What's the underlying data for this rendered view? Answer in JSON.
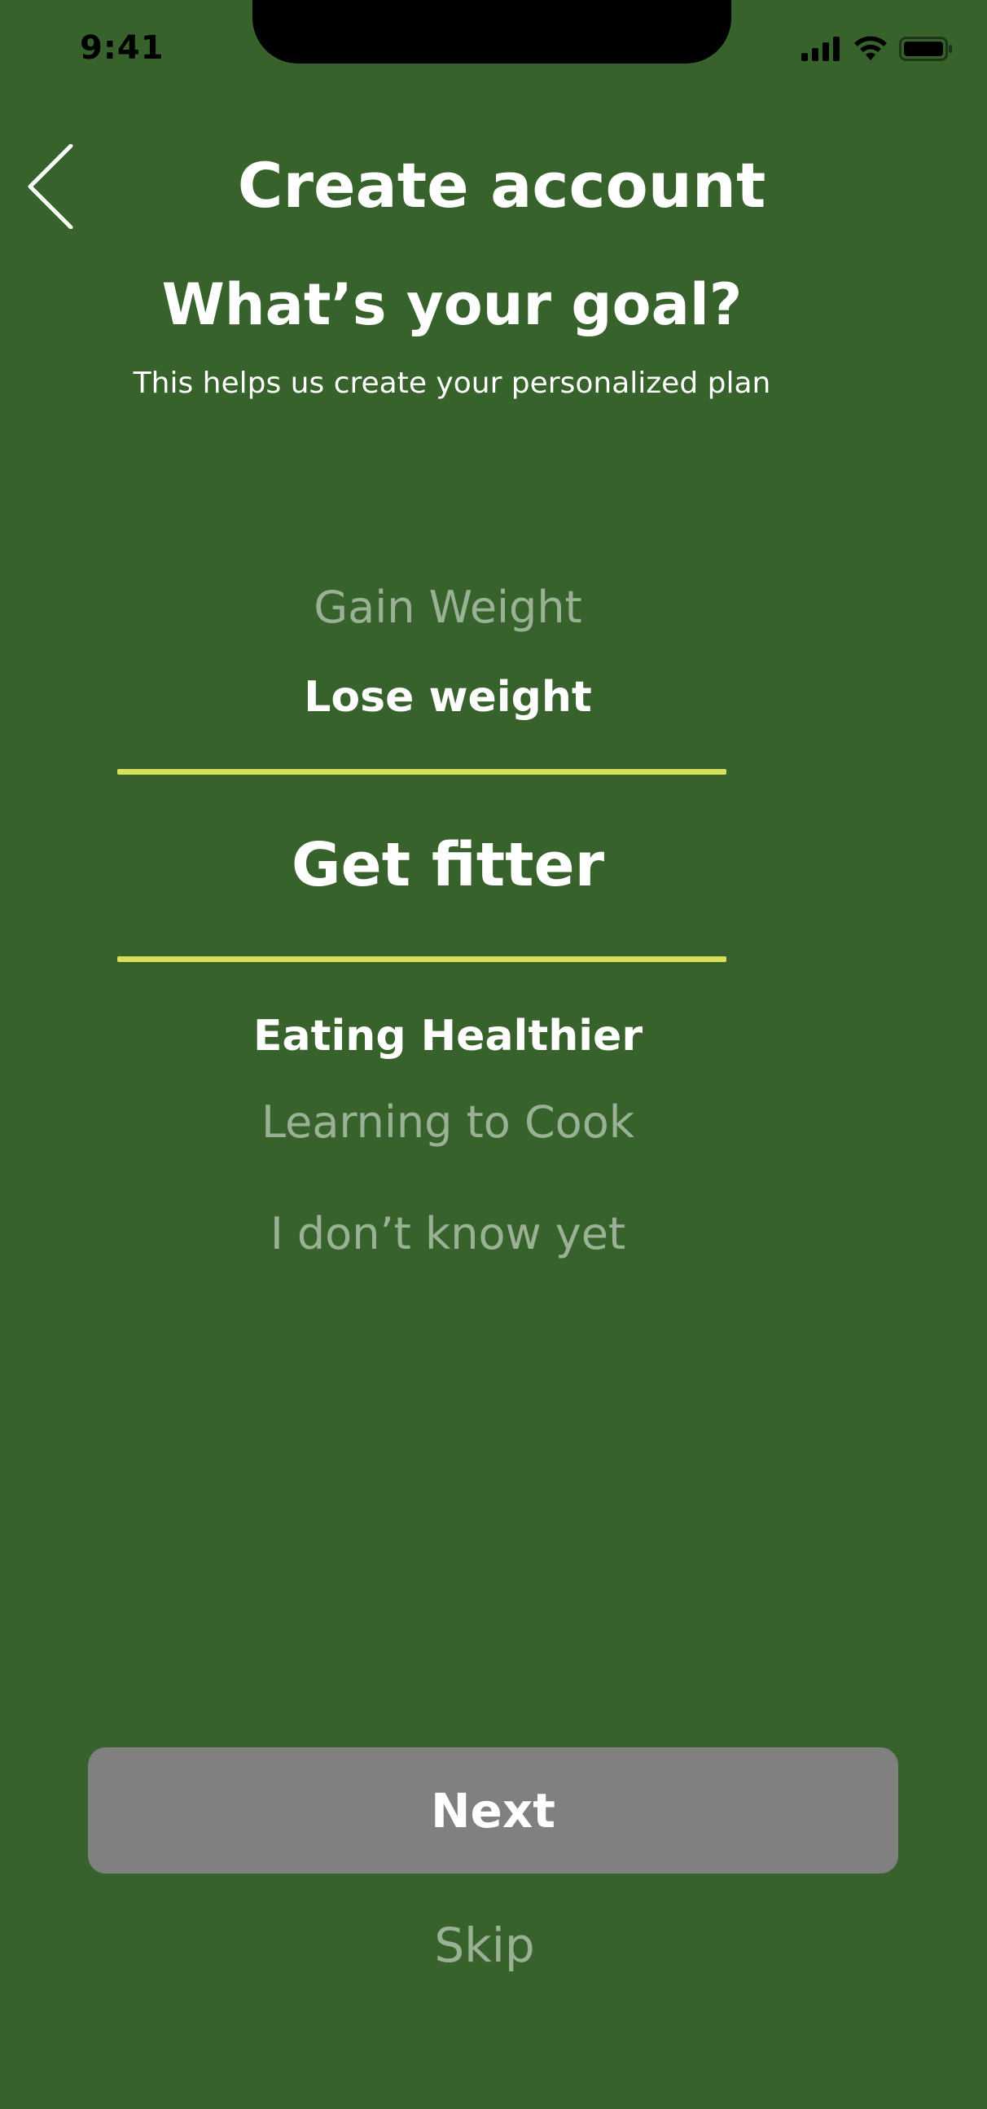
{
  "colors": {
    "background": "#37622b",
    "accent": "#d6e05a",
    "button": "#808080",
    "notch": "#000000"
  },
  "status_bar": {
    "time": "9:41",
    "icons": [
      "cellular-signal-icon",
      "wifi-icon",
      "battery-icon"
    ]
  },
  "header": {
    "back_icon": "chevron-left-icon",
    "title": "Create account"
  },
  "question": {
    "title": "What’s your goal?",
    "subtitle": "This helps us create your personalized plan"
  },
  "goal_picker": {
    "options": [
      "Gain Weight",
      "Lose weight",
      "Get fitter",
      "Eating Healthier",
      "Learning to Cook",
      "I don’t know yet"
    ],
    "selected": "Get fitter"
  },
  "actions": {
    "next_label": "Next",
    "skip_label": "Skip"
  }
}
